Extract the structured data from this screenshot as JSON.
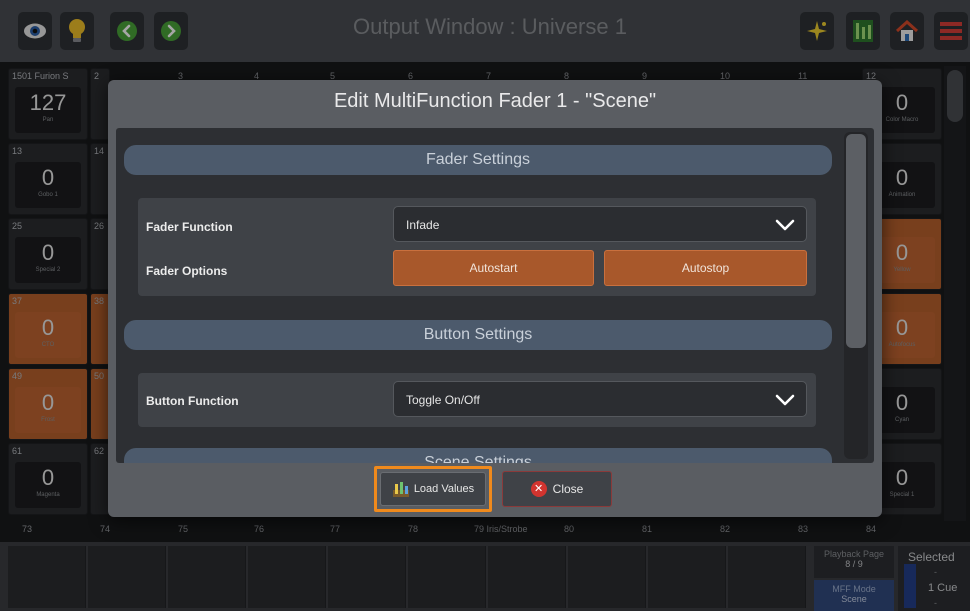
{
  "topbar": {
    "title": "Output Window : Universe 1"
  },
  "grid": {
    "header_labels": [
      "1501 Furion S",
      "2",
      "3",
      "4",
      "5",
      "6",
      "7",
      "8",
      "9",
      "10",
      "11",
      "12"
    ],
    "left_cells": [
      {
        "num": "1501 Furion S",
        "value": "127",
        "label": "Pan"
      },
      {
        "num": "13",
        "value": "0",
        "label": "Gobo 1"
      },
      {
        "num": "25",
        "value": "0",
        "label": "Special 2"
      },
      {
        "num": "37",
        "value": "0",
        "label": "CTO"
      },
      {
        "num": "49",
        "value": "0",
        "label": "Frost"
      },
      {
        "num": "61",
        "value": "0",
        "label": "Magenta"
      }
    ],
    "left_side_nums": [
      "2",
      "14",
      "26",
      "38",
      "50",
      "62"
    ],
    "right_cells": [
      {
        "num": "12",
        "value": "0",
        "label": "Color Macro"
      },
      {
        "num": "",
        "value": "0",
        "label": "Animation"
      },
      {
        "num": "",
        "value": "0",
        "label": "Yellow"
      },
      {
        "num": "",
        "value": "0",
        "label": "Autofocus"
      },
      {
        "num": "",
        "value": "0",
        "label": "Cyan"
      },
      {
        "num": "",
        "value": "0",
        "label": "Special 1"
      }
    ],
    "bottom_row_nums": [
      "73",
      "74",
      "75",
      "76",
      "77",
      "78",
      "79 Iris/Strobe",
      "80",
      "81",
      "82",
      "83",
      "84"
    ]
  },
  "bottombar": {
    "playback_page_label": "Playback Page",
    "playback_page_value": "8 / 9",
    "mff_mode_label": "MFF Mode",
    "mff_mode_value": "Scene",
    "selected_label": "Selected",
    "selected_dash": "-",
    "selected_cue": "1 Cue",
    "selected_dash2": "-"
  },
  "dialog": {
    "title": "Edit MultiFunction Fader 1 - \"Scene\"",
    "fader_settings": {
      "header": "Fader Settings",
      "function_label": "Fader Function",
      "function_value": "Infade",
      "options_label": "Fader Options",
      "autostart_label": "Autostart",
      "autostop_label": "Autostop"
    },
    "button_settings": {
      "header": "Button Settings",
      "function_label": "Button Function",
      "function_value": "Toggle On/Off"
    },
    "scene_settings": {
      "header": "Scene Settings"
    },
    "load_values_label": "Load Values",
    "close_label": "Close"
  },
  "colors": {
    "accent_orange": "#f08a1c",
    "option_button": "#a8582b",
    "section_header": "#4c5a6c",
    "close_red": "#d2342f"
  }
}
